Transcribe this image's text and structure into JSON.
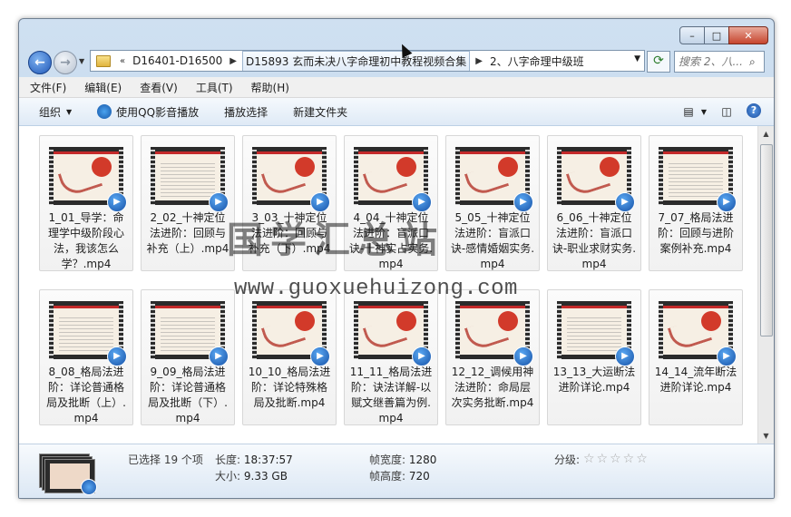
{
  "window": {
    "caption_buttons": [
      "–",
      "□",
      "✕"
    ]
  },
  "navigation": {
    "back_icon": "back-arrow-icon",
    "forward_icon": "forward-arrow-icon",
    "breadcrumb": {
      "overflow": "«",
      "items": [
        "D16401-D16500",
        "D15893 玄而未决八字命理初中教程视频合集",
        "2、八字命理中级班"
      ]
    },
    "search_placeholder": "搜索 2、八..."
  },
  "menu": {
    "items": [
      "文件(F)",
      "编辑(E)",
      "查看(V)",
      "工具(T)",
      "帮助(H)"
    ]
  },
  "commands": {
    "organize": "组织",
    "play_qq": "使用QQ影音播放",
    "playlist": "播放选择",
    "new_folder": "新建文件夹"
  },
  "files": [
    {
      "label": "1_01_导学：命理学中级阶段心法，我该怎么学？.mp4",
      "style": "art"
    },
    {
      "label": "2_02_十神定位法进阶：回顾与补充（上）.mp4",
      "style": "text"
    },
    {
      "label": "3_03_十神定位法进阶：回顾与补充（下）.mp4",
      "style": "art"
    },
    {
      "label": "4_04_十神定位法进阶：盲派口诀-十神实占实务.mp4",
      "style": "art"
    },
    {
      "label": "5_05_十神定位法进阶：盲派口诀-感情婚姻实务.mp4",
      "style": "art"
    },
    {
      "label": "6_06_十神定位法进阶：盲派口诀-职业求财实务.mp4",
      "style": "art"
    },
    {
      "label": "7_07_格局法进阶：回顾与进阶案例补充.mp4",
      "style": "text"
    },
    {
      "label": "8_08_格局法进阶：详论普通格局及批断（上）.mp4",
      "style": "text"
    },
    {
      "label": "9_09_格局法进阶：详论普通格局及批断（下）.mp4",
      "style": "text"
    },
    {
      "label": "10_10_格局法进阶：详论特殊格局及批断.mp4",
      "style": "art"
    },
    {
      "label": "11_11_格局法进阶：诀法详解-以赋文继善篇为例.mp4",
      "style": "art"
    },
    {
      "label": "12_12_调候用神法进阶：命局层次实务批断.mp4",
      "style": "art"
    },
    {
      "label": "13_13_大运断法进阶详论.mp4",
      "style": "text"
    },
    {
      "label": "14_14_流年断法进阶详论.mp4",
      "style": "art"
    }
  ],
  "details": {
    "selected": "已选择 19 个项",
    "duration_label": "长度:",
    "duration": "18:37:57",
    "size_label": "大小:",
    "size": "9.33 GB",
    "width_label": "帧宽度:",
    "width": "1280",
    "height_label": "帧高度:",
    "height": "720",
    "rating_label": "分级:",
    "rating_stars": "☆☆☆☆☆"
  },
  "watermark": {
    "title": "国学汇总站",
    "url": "www.guoxuehuizong.com"
  },
  "colors": {
    "accent": "#1651a6",
    "thumb_red": "#c42a2a",
    "chrome": "#b9d1ea"
  }
}
